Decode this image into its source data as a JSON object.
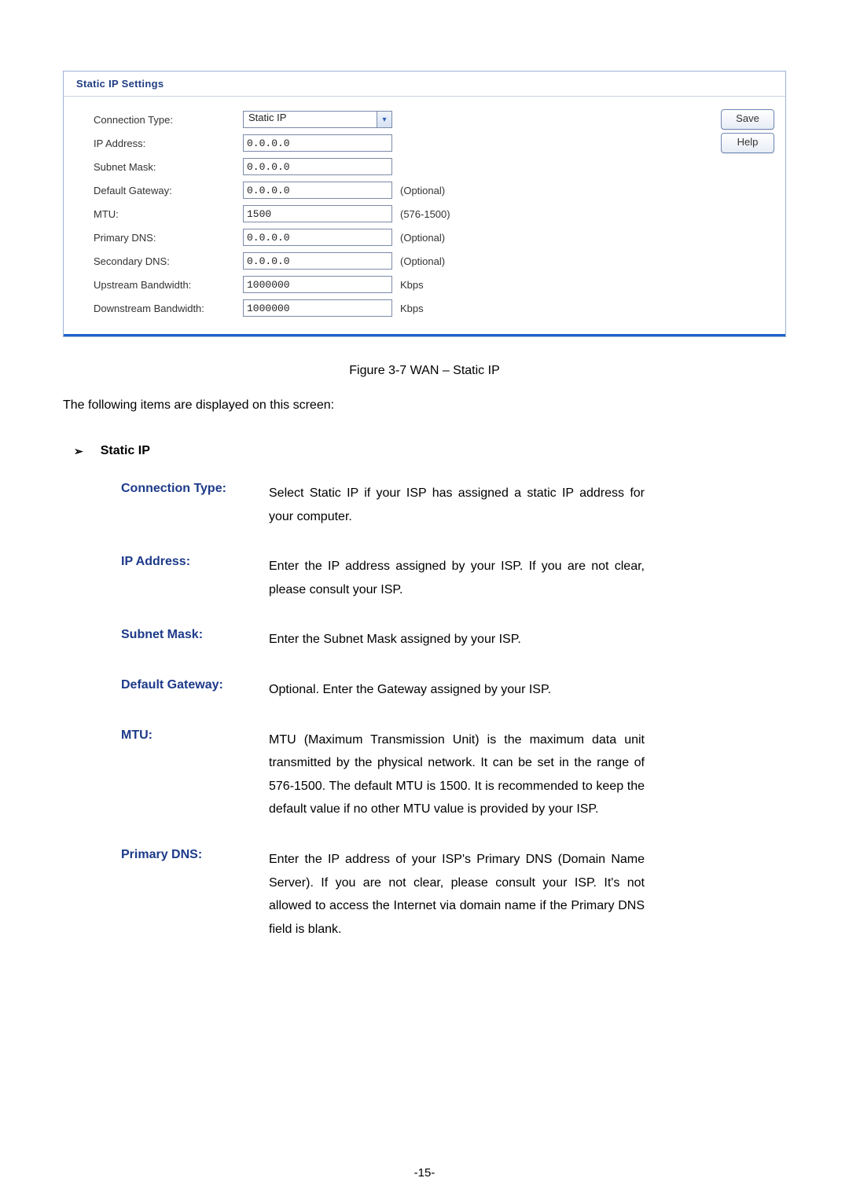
{
  "panel": {
    "title": "Static IP Settings",
    "fields": {
      "connection_type": {
        "label": "Connection Type:",
        "value": "Static IP"
      },
      "ip_address": {
        "label": "IP Address:",
        "value": "0.0.0.0"
      },
      "subnet_mask": {
        "label": "Subnet Mask:",
        "value": "0.0.0.0"
      },
      "default_gateway": {
        "label": "Default Gateway:",
        "value": "0.0.0.0",
        "hint": "(Optional)"
      },
      "mtu": {
        "label": "MTU:",
        "value": "1500",
        "hint": "(576-1500)"
      },
      "primary_dns": {
        "label": "Primary DNS:",
        "value": "0.0.0.0",
        "hint": "(Optional)"
      },
      "secondary_dns": {
        "label": "Secondary DNS:",
        "value": "0.0.0.0",
        "hint": "(Optional)"
      },
      "upstream": {
        "label": "Upstream Bandwidth:",
        "value": "1000000",
        "hint": "Kbps"
      },
      "downstream": {
        "label": "Downstream Bandwidth:",
        "value": "1000000",
        "hint": "Kbps"
      }
    },
    "buttons": {
      "save": "Save",
      "help": "Help"
    }
  },
  "figure_caption": "Figure 3-7 WAN – Static IP",
  "intro_text": "The following items are displayed on this screen:",
  "section_heading": "Static IP",
  "defs": [
    {
      "term": "Connection Type:",
      "desc": "Select Static IP if your ISP has assigned a static IP address for your computer."
    },
    {
      "term": "IP Address:",
      "desc": "Enter the IP address assigned by your ISP. If you are not clear, please consult your ISP."
    },
    {
      "term": "Subnet Mask:",
      "desc": "Enter the Subnet Mask assigned by your ISP."
    },
    {
      "term": "Default Gateway:",
      "desc": "Optional. Enter the Gateway assigned by your ISP."
    },
    {
      "term": "MTU:",
      "desc": "MTU (Maximum Transmission Unit) is the maximum data unit transmitted by the physical network. It can be set in the range of 576-1500. The default MTU is 1500. It is recommended to keep the default value if no other MTU value is provided by your ISP."
    },
    {
      "term": "Primary DNS:",
      "desc": "Enter the IP address of your ISP's Primary DNS (Domain Name Server). If you are not clear, please consult your ISP. It's not allowed to access the Internet via domain name if the Primary DNS field is blank."
    }
  ],
  "page_number": "-15-"
}
